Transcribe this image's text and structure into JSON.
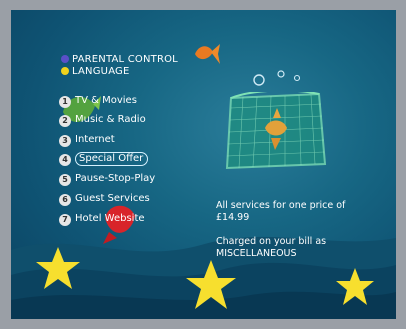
{
  "quick_menu": [
    {
      "label": "PARENTAL CONTROL",
      "dot_color": "#5a4fc8"
    },
    {
      "label": "LANGUAGE",
      "dot_color": "#f0d21c"
    }
  ],
  "menu": [
    {
      "number": "1",
      "label": "TV & Movies"
    },
    {
      "number": "2",
      "label": "Music & Radio"
    },
    {
      "number": "3",
      "label": "Internet"
    },
    {
      "number": "4",
      "label": "Special Offer",
      "selected": true
    },
    {
      "number": "5",
      "label": "Pause-Stop-Play"
    },
    {
      "number": "6",
      "label": "Guest Services"
    },
    {
      "number": "7",
      "label": "Hotel Website"
    }
  ],
  "offer": {
    "line1": "All services for one price of",
    "price": "£14.99",
    "line2": "Charged on your bill as",
    "category": "MISCELLANEOUS"
  },
  "colors": {
    "background": "#176784",
    "frame": "#9a9fa6",
    "star": "#f7df2e",
    "fish_orange": "#e97a22",
    "fish_red": "#d8242a"
  }
}
